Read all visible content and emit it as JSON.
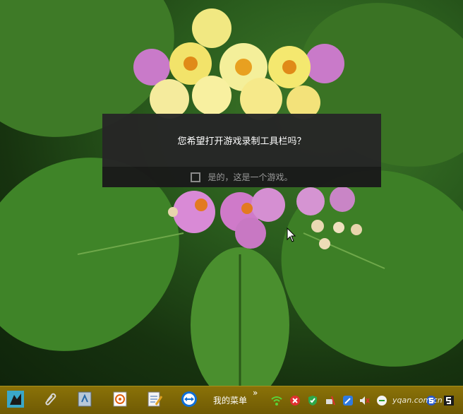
{
  "dialog": {
    "question": "您希望打开游戏录制工具栏吗？",
    "checkbox_label": "是的，这是一个游戏。",
    "checkbox_checked": false
  },
  "taskbar": {
    "menu_label": "我的菜单",
    "more_glyph": "»",
    "icons": [
      "game-app-icon",
      "paperclip-icon",
      "notebook-icon",
      "paint-app-icon",
      "notepad-icon",
      "teamviewer-icon"
    ],
    "tray_icons": [
      "wifi-icon",
      "stop-icon",
      "shield-icon",
      "network-icon",
      "edit-icon",
      "volume-icon",
      "ime-icon",
      "s-icon"
    ]
  },
  "watermark": "yqan.com.cn"
}
